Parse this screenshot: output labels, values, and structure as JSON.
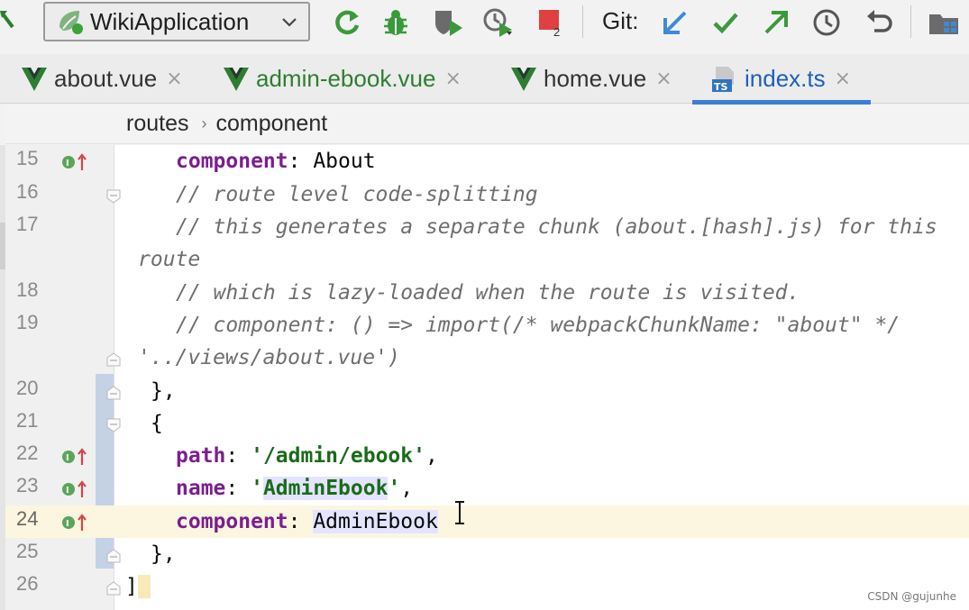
{
  "toolbar": {
    "run_config": "WikiApplication",
    "git_label": "Git:",
    "stop_badge": "2"
  },
  "tabs": [
    {
      "label": "about.vue",
      "close": "×"
    },
    {
      "label": "admin-ebook.vue",
      "close": "×"
    },
    {
      "label": "home.vue",
      "close": "×"
    },
    {
      "label": "index.ts",
      "close": "×",
      "badge": "TS"
    }
  ],
  "breadcrumb": {
    "items": [
      "routes",
      "component"
    ],
    "separator": "›"
  },
  "editor": {
    "lines": [
      {
        "num": "15",
        "prop": "component",
        "colon": ": ",
        "value": "About"
      },
      {
        "num": "16",
        "comment": "// route level code-splitting"
      },
      {
        "num": "17",
        "comment": "// this generates a separate chunk (about.[hash].js) for this",
        "wrap": "route"
      },
      {
        "num": "18",
        "comment": "// which is lazy-loaded when the route is visited."
      },
      {
        "num": "19",
        "comment": "// component: () => import(/* webpackChunkName: \"about\" */",
        "wrap": "'../views/about.vue')"
      },
      {
        "num": "20",
        "text": "},"
      },
      {
        "num": "21",
        "text": "{"
      },
      {
        "num": "22",
        "prop": "path",
        "colon": ": ",
        "str": "'/admin/ebook'",
        "tail": ","
      },
      {
        "num": "23",
        "prop": "name",
        "colon": ": ",
        "quote": "'",
        "str_hl": "AdminEbook",
        "str_end": "'",
        "tail": ","
      },
      {
        "num": "24",
        "prop": "component",
        "colon": ": ",
        "value_hl": "AdminEbook"
      },
      {
        "num": "25",
        "text": "},"
      },
      {
        "num": "26",
        "text": "]"
      }
    ]
  },
  "watermark": "CSDN @gujunhe",
  "colors": {
    "accent": "#3d7dd6",
    "keyword": "#7a1f8f",
    "string": "#1a6b1a",
    "comment": "#6e6e6e",
    "vue_green": "#2e7d32"
  }
}
